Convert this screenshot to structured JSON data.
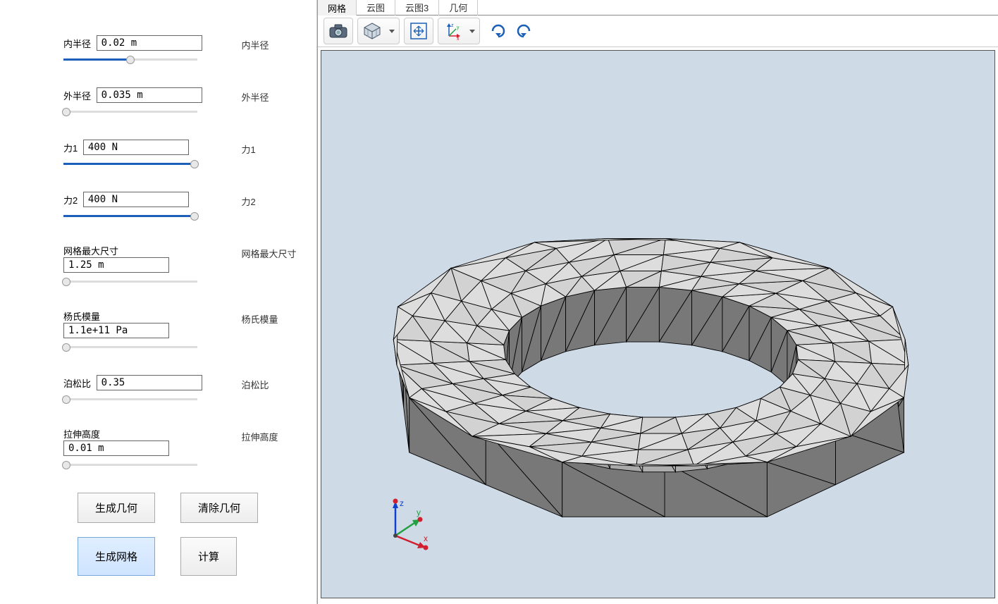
{
  "params": [
    {
      "key": "inner_radius",
      "label": "内半径",
      "value": "0.02 m",
      "fill": 50,
      "right": "内半径"
    },
    {
      "key": "outer_radius",
      "label": "外半径",
      "value": "0.035 m",
      "fill": 2,
      "right": "外半径"
    },
    {
      "key": "force1",
      "label": "力1",
      "value": "400 N",
      "fill": 98,
      "right": "力1"
    },
    {
      "key": "force2",
      "label": "力2",
      "value": "400 N",
      "fill": 98,
      "right": "力2"
    },
    {
      "key": "mesh_max",
      "label": "网格最大尺寸",
      "value": "1.25 m",
      "fill": 2,
      "right": "网格最大尺寸"
    },
    {
      "key": "youngs",
      "label": "杨氏模量",
      "value": "1.1e+11 Pa",
      "fill": 2,
      "right": "杨氏模量"
    },
    {
      "key": "poisson",
      "label": "泊松比",
      "value": "0.35",
      "fill": 2,
      "right": "泊松比"
    },
    {
      "key": "extrude",
      "label": "拉伸高度",
      "value": "0.01 m",
      "fill": 2,
      "right": "拉伸高度"
    }
  ],
  "buttons": {
    "gen_geom": "生成几何",
    "clear_geom": "清除几何",
    "gen_mesh": "生成网格",
    "compute": "计算"
  },
  "tabs": [
    "网格",
    "云图",
    "云图3",
    "几何"
  ],
  "active_tab": 0,
  "toolbar_icons": [
    "camera-icon",
    "cube-icon",
    "fit-icon",
    "axis-orient-icon",
    "rotate-cw-icon",
    "rotate-ccw-icon"
  ],
  "axes_labels": {
    "x": "x",
    "y": "y",
    "z": "z"
  }
}
